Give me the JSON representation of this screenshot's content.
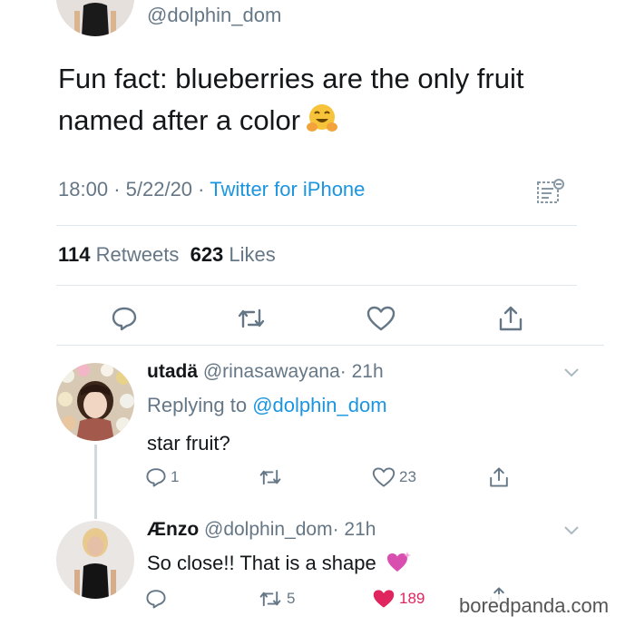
{
  "top_tweet": {
    "handle": "@dolphin_dom",
    "text_line1": "Fun fact: blueberries are the only fruit",
    "text_line2": "named after a color",
    "time": "18:00",
    "date": "5/22/20",
    "source": "Twitter for iPhone",
    "sep": "·",
    "retweets_count": "114",
    "retweets_label": "Retweets",
    "likes_count": "623",
    "likes_label": "Likes"
  },
  "replies": [
    {
      "name": "utadä",
      "handle": "@rinasawayana",
      "age": "· 21h",
      "replying_prefix": "Replying to",
      "replying_handle": "@dolphin_dom",
      "text": "star fruit?",
      "reply_count": "1",
      "retweet_count": "",
      "like_count": "23"
    },
    {
      "name": "Ænzo",
      "handle": "@dolphin_dom",
      "age": "· 21h",
      "text": "So close!! That is a shape",
      "reply_count": "",
      "retweet_count": "5",
      "like_count": "189"
    }
  ],
  "watermark": "boredpanda.com",
  "colors": {
    "link": "#1b95e0",
    "muted": "#657786",
    "like_red": "#e0245e",
    "divider": "#e1e8ed"
  },
  "icons": [
    "reply-icon",
    "retweet-icon",
    "like-icon",
    "share-icon",
    "analytics-icon",
    "chevron-down-icon",
    "hugging-face-emoji",
    "sparkling-heart-emoji"
  ]
}
